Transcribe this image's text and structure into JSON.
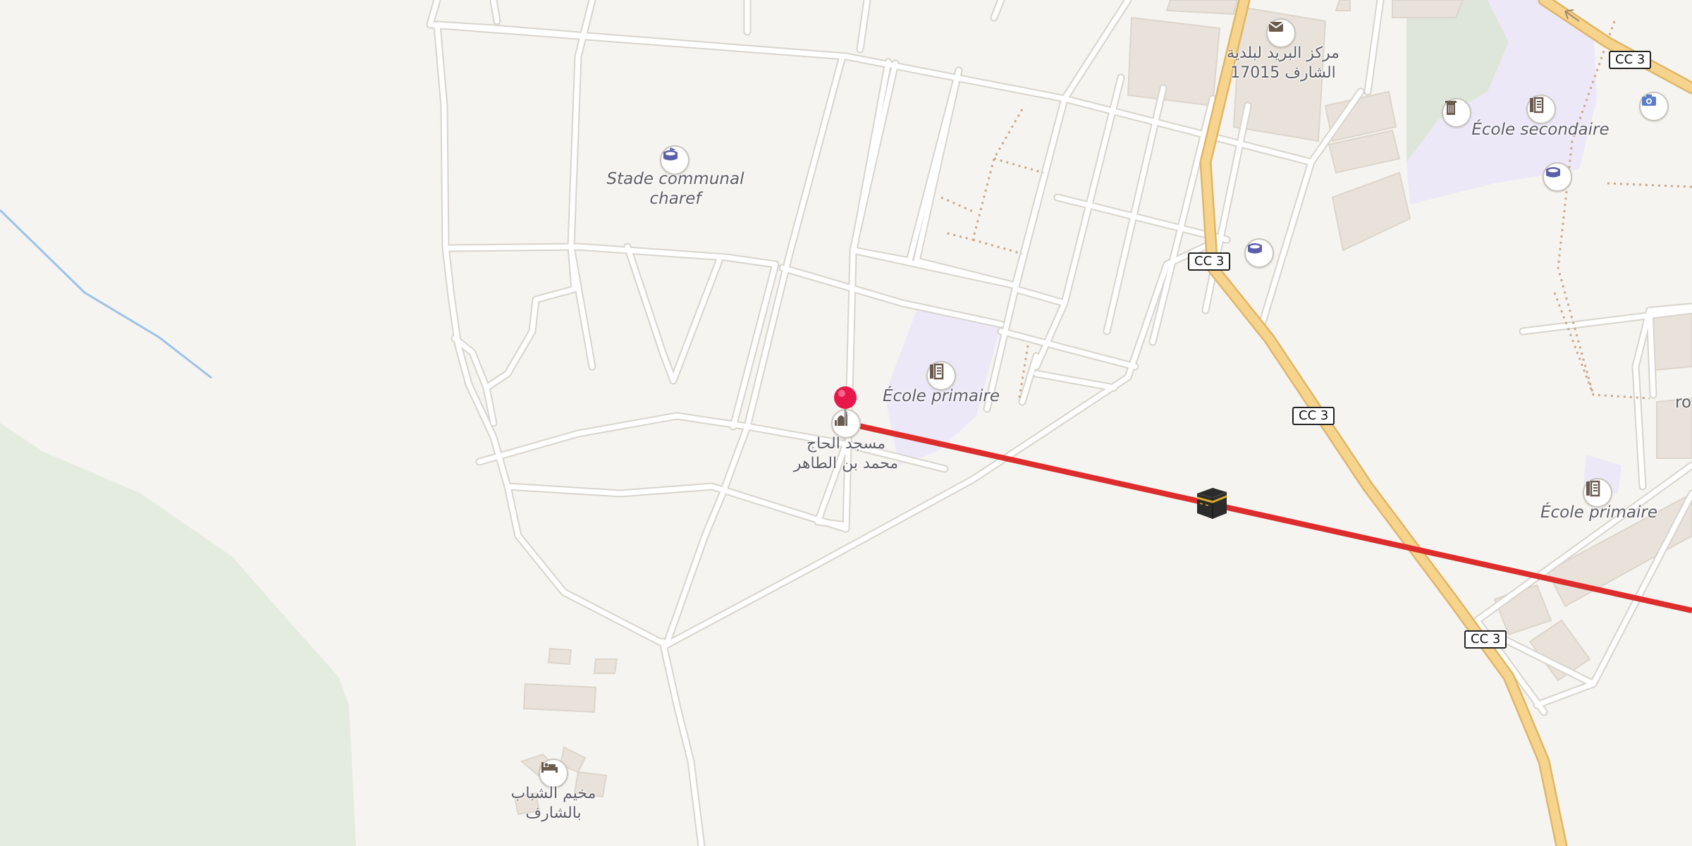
{
  "map": {
    "labels": {
      "stadium": "Stade communal\ncharef",
      "primary_school_center": "École primaire",
      "mosque": "مسجد الحاج\nمحمد بن الطاهر",
      "post_office_line1": "مركز البريد لبلدية",
      "post_office_line2": "الشارف 17015",
      "secondary_school": "École secondaire",
      "primary_school_right": "École primaire",
      "youth_camp": "مخيم الشباب\nبالشارف",
      "edge_partial": "ro"
    },
    "road_refs": [
      "CC 3",
      "CC 3",
      "CC 3",
      "CC 3"
    ],
    "icons": {
      "stadium": "stadium-icon",
      "school": "school-icon",
      "mosque": "mosque-icon",
      "post_office": "mail-icon",
      "sports": "sports-centre-icon",
      "camera": "camera-icon",
      "waste": "waste-basket-icon",
      "hostel": "hostel-icon",
      "marker": "location-pin-icon",
      "qibla": "kaaba-icon"
    },
    "colors": {
      "background": "#f6f4f0",
      "road": "#ffffff",
      "primary_road": "#f7d48e",
      "school_area": "#ede8f8",
      "building": "#e8e2da",
      "park": "#e4ecdf",
      "water": "#9cc3ec",
      "qibla_line": "#dd2c2c",
      "pin": "#e8174b",
      "icon_tint": "#5a5fa8"
    }
  }
}
